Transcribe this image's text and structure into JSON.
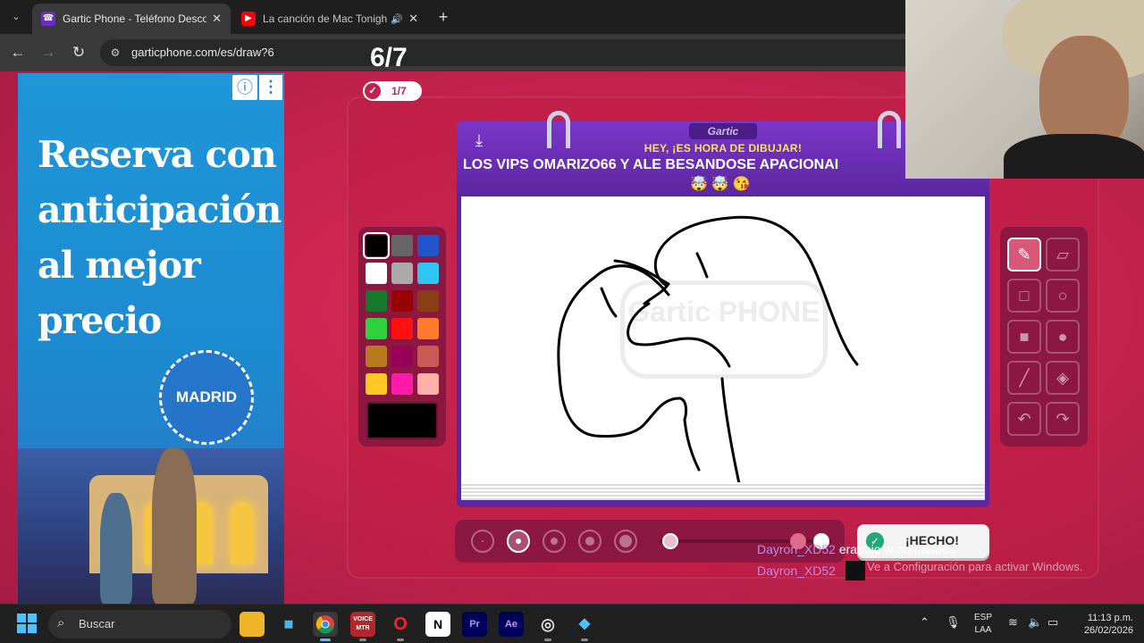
{
  "browser": {
    "tabs": [
      {
        "title": "Gartic Phone - Teléfono Descon",
        "close": "✕"
      },
      {
        "title": "La canción de Mac Tonight/",
        "close": "✕"
      }
    ],
    "new_tab": "+",
    "url": "garticphone.com/es/draw?6"
  },
  "ad": {
    "headline": "Reserva con anticipación al mejor precio",
    "badge": "MADRID",
    "info_icon": "ⓘ",
    "menu_icon": "⋮"
  },
  "game": {
    "round": "6/7",
    "round_pill": "1/7",
    "brand_tag": "Gartic",
    "subtitle": "HEY, ¡ES HORA DE DIBUJAR!",
    "prompt": "LOS VIPS OMARIZO66 Y ALE BESANDOSE APACIONAI",
    "emojis": "🤯🤯😘",
    "watermark": "Gartic PHONE",
    "done_label": "¡HECHO!",
    "colors": {
      "palette": [
        "#000000",
        "#666666",
        "#1e56c9",
        "#ffffff",
        "#aaaaaa",
        "#2fc6f3",
        "#167a2c",
        "#990000",
        "#8a3e16",
        "#2fd13f",
        "#ff1111",
        "#ff7a2a",
        "#b87a1e",
        "#990058",
        "#c85a52",
        "#ffc822",
        "#ff1aa8",
        "#ffb0a8"
      ],
      "selected": "#000000",
      "accent": "#c9244f",
      "board": "#5b27a0"
    },
    "tools": [
      "pencil-icon",
      "eraser-icon",
      "square-outline-icon",
      "circle-outline-icon",
      "square-fill-icon",
      "circle-fill-icon",
      "line-icon",
      "fill-bucket-icon",
      "undo-icon",
      "redo-icon"
    ]
  },
  "chat": [
    {
      "user": "Dayron_XD52",
      "message": "era mio w no mames"
    },
    {
      "user": "Dayron_XD52",
      "message": ""
    }
  ],
  "system_watermark": "Ve a Configuración para activar Windows.",
  "taskbar": {
    "search_placeholder": "Buscar",
    "lang_line1": "ESP",
    "lang_line2": "LAA",
    "time": "11:13 p.m.",
    "date": "26/02/2026"
  }
}
